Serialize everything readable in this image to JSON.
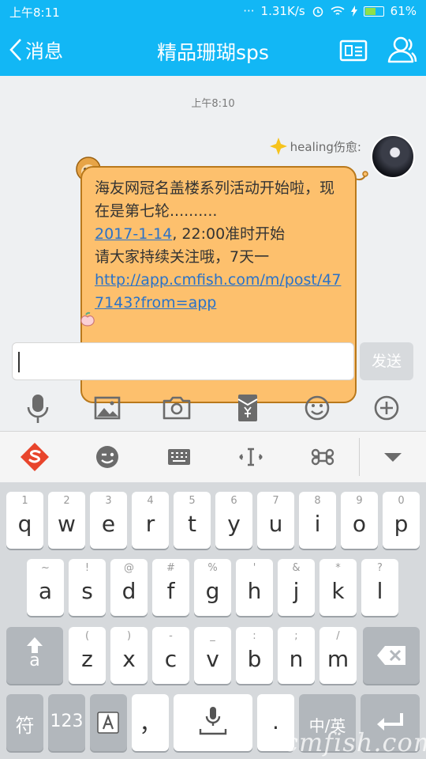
{
  "status_bar": {
    "time": "上午8:11",
    "dots": "···",
    "net_speed": "1.31K/s",
    "battery": "61%",
    "battery_level": 0.61
  },
  "header": {
    "back_label": "消息",
    "title": "精品珊瑚sps"
  },
  "chat": {
    "timestamp": "上午8:10",
    "sender_name": "healing伤愈:",
    "message": {
      "line1": "海友网冠名盖楼系列活动开始啦，现在是第七轮..........",
      "date_link": "2017-1-14",
      "after_date": ", 22:00准时开始",
      "line3": "请大家持续关注哦，7天一",
      "url": "http://app.cmfish.com/m/post/477143?from=app"
    }
  },
  "composer": {
    "input_value": "",
    "send_label": "发送"
  },
  "toolbar_icons": [
    "microphone-icon",
    "image-icon",
    "camera-icon",
    "red-packet-icon",
    "emoji-icon",
    "plus-icon"
  ],
  "keyboard_toolbar_icons": [
    "sogou-logo",
    "wink-emoji-icon",
    "keyboard-icon",
    "cursor-move-icon",
    "command-icon",
    "collapse-icon"
  ],
  "keyboard": {
    "row1": [
      {
        "hint": "1",
        "key": "q"
      },
      {
        "hint": "2",
        "key": "w"
      },
      {
        "hint": "3",
        "key": "e"
      },
      {
        "hint": "4",
        "key": "r"
      },
      {
        "hint": "5",
        "key": "t"
      },
      {
        "hint": "6",
        "key": "y"
      },
      {
        "hint": "7",
        "key": "u"
      },
      {
        "hint": "8",
        "key": "i"
      },
      {
        "hint": "9",
        "key": "o"
      },
      {
        "hint": "0",
        "key": "p"
      }
    ],
    "row2": [
      {
        "hint": "~",
        "key": "a"
      },
      {
        "hint": "!",
        "key": "s"
      },
      {
        "hint": "@",
        "key": "d"
      },
      {
        "hint": "#",
        "key": "f"
      },
      {
        "hint": "%",
        "key": "g"
      },
      {
        "hint": "'",
        "key": "h"
      },
      {
        "hint": "&",
        "key": "j"
      },
      {
        "hint": "*",
        "key": "k"
      },
      {
        "hint": "?",
        "key": "l"
      }
    ],
    "row3": [
      {
        "hint": "(",
        "key": "z"
      },
      {
        "hint": ")",
        "key": "x"
      },
      {
        "hint": "-",
        "key": "c"
      },
      {
        "hint": "_",
        "key": "v"
      },
      {
        "hint": ":",
        "key": "b"
      },
      {
        "hint": ";",
        "key": "n"
      },
      {
        "hint": "/",
        "key": "m"
      }
    ],
    "shift_label": "a",
    "bottom": {
      "symbols": "符",
      "numbers": "123",
      "comma": "，",
      "period": ".",
      "lang": "中/英"
    }
  },
  "watermark": "cmfish.com",
  "colors": {
    "accent": "#12b7f5",
    "bubble": "#fdc06d",
    "bubble_border": "#b9791c",
    "link": "#2a72c8"
  }
}
